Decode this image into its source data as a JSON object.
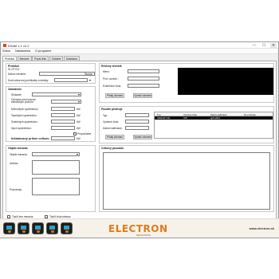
{
  "window": {
    "title": "EDaM 1.1 v2.2",
    "controls": {
      "minimize": "—",
      "maximize": "☐",
      "close": "✕"
    }
  },
  "menu": [
    "Súbor",
    "Nastavenia",
    "O programe"
  ],
  "tabs": [
    "Protokol",
    "Meranie",
    "Popis léku",
    "Ostatné",
    "Databáza"
  ],
  "protokol": {
    "title": "Protokol",
    "number": "ID CP+D1",
    "labels": {
      "datum": "Dátum merania:",
      "dalsia": "Dodi odborovej prehliadky a skúšky:"
    },
    "datum_value": "",
    "datum_unit": "Štvrtok",
    "dalsia_value": ""
  },
  "zariadenie": {
    "title": "Zariadenie",
    "labels": [
      "Skúšané:",
      "Ochrana pred úrazom elektrickým prúdom:",
      "Mohovitých spotrebičov:",
      "Tepelných spotrebičov:",
      "Svetelných spotrebičov:",
      "Iných spotrebičov:"
    ],
    "units": [
      "kW",
      "kW",
      "kW",
      "kW"
    ],
    "checkbox_label": "Prepočítané",
    "installed_label": "Inštalovaný príkon celkom",
    "installed_unit": "kW"
  },
  "revizny_technik": {
    "title": "Revízny technik",
    "labels": [
      "Meno:",
      "Prof. osvedč.:",
      "Evidenčné číslo:"
    ],
    "add_button": "Pridaj záznam",
    "delete_button": "Vymaž záznam"
  },
  "pouzite_pristroje": {
    "title": "Použité prístroje",
    "labels": [
      "Typ:",
      "Výrobné číslo:",
      "Dátum kalibrácie:"
    ],
    "columns": [
      "Typ",
      "Výrobné číslo",
      "Dátum kalibrácie",
      "Do prístroja"
    ],
    "rows": [
      [
        "VARIANT ML",
        "X15",
        "april 2011",
        ""
      ]
    ],
    "add_button": "Pridaj záznam",
    "delete_button": "Vymaž záznam"
  },
  "objekt": {
    "title": "Objekt merania",
    "labels": [
      "Objekt merania:",
      "Adresa:",
      "Poznámky:"
    ]
  },
  "celkovy_posudok": {
    "title": "Celkový posudok"
  },
  "bottom": {
    "opt1": "Tlačiť bez merania",
    "opt2": "Tlačiť čísla strános"
  },
  "banner": {
    "brand": "ELECTRON",
    "brand_sub": "MEASURING",
    "url": "www.electron.sk"
  },
  "colors": {
    "brand_orange": "#e07a18",
    "selected_row": "#0a0a0a",
    "preview_black": "#000000"
  }
}
